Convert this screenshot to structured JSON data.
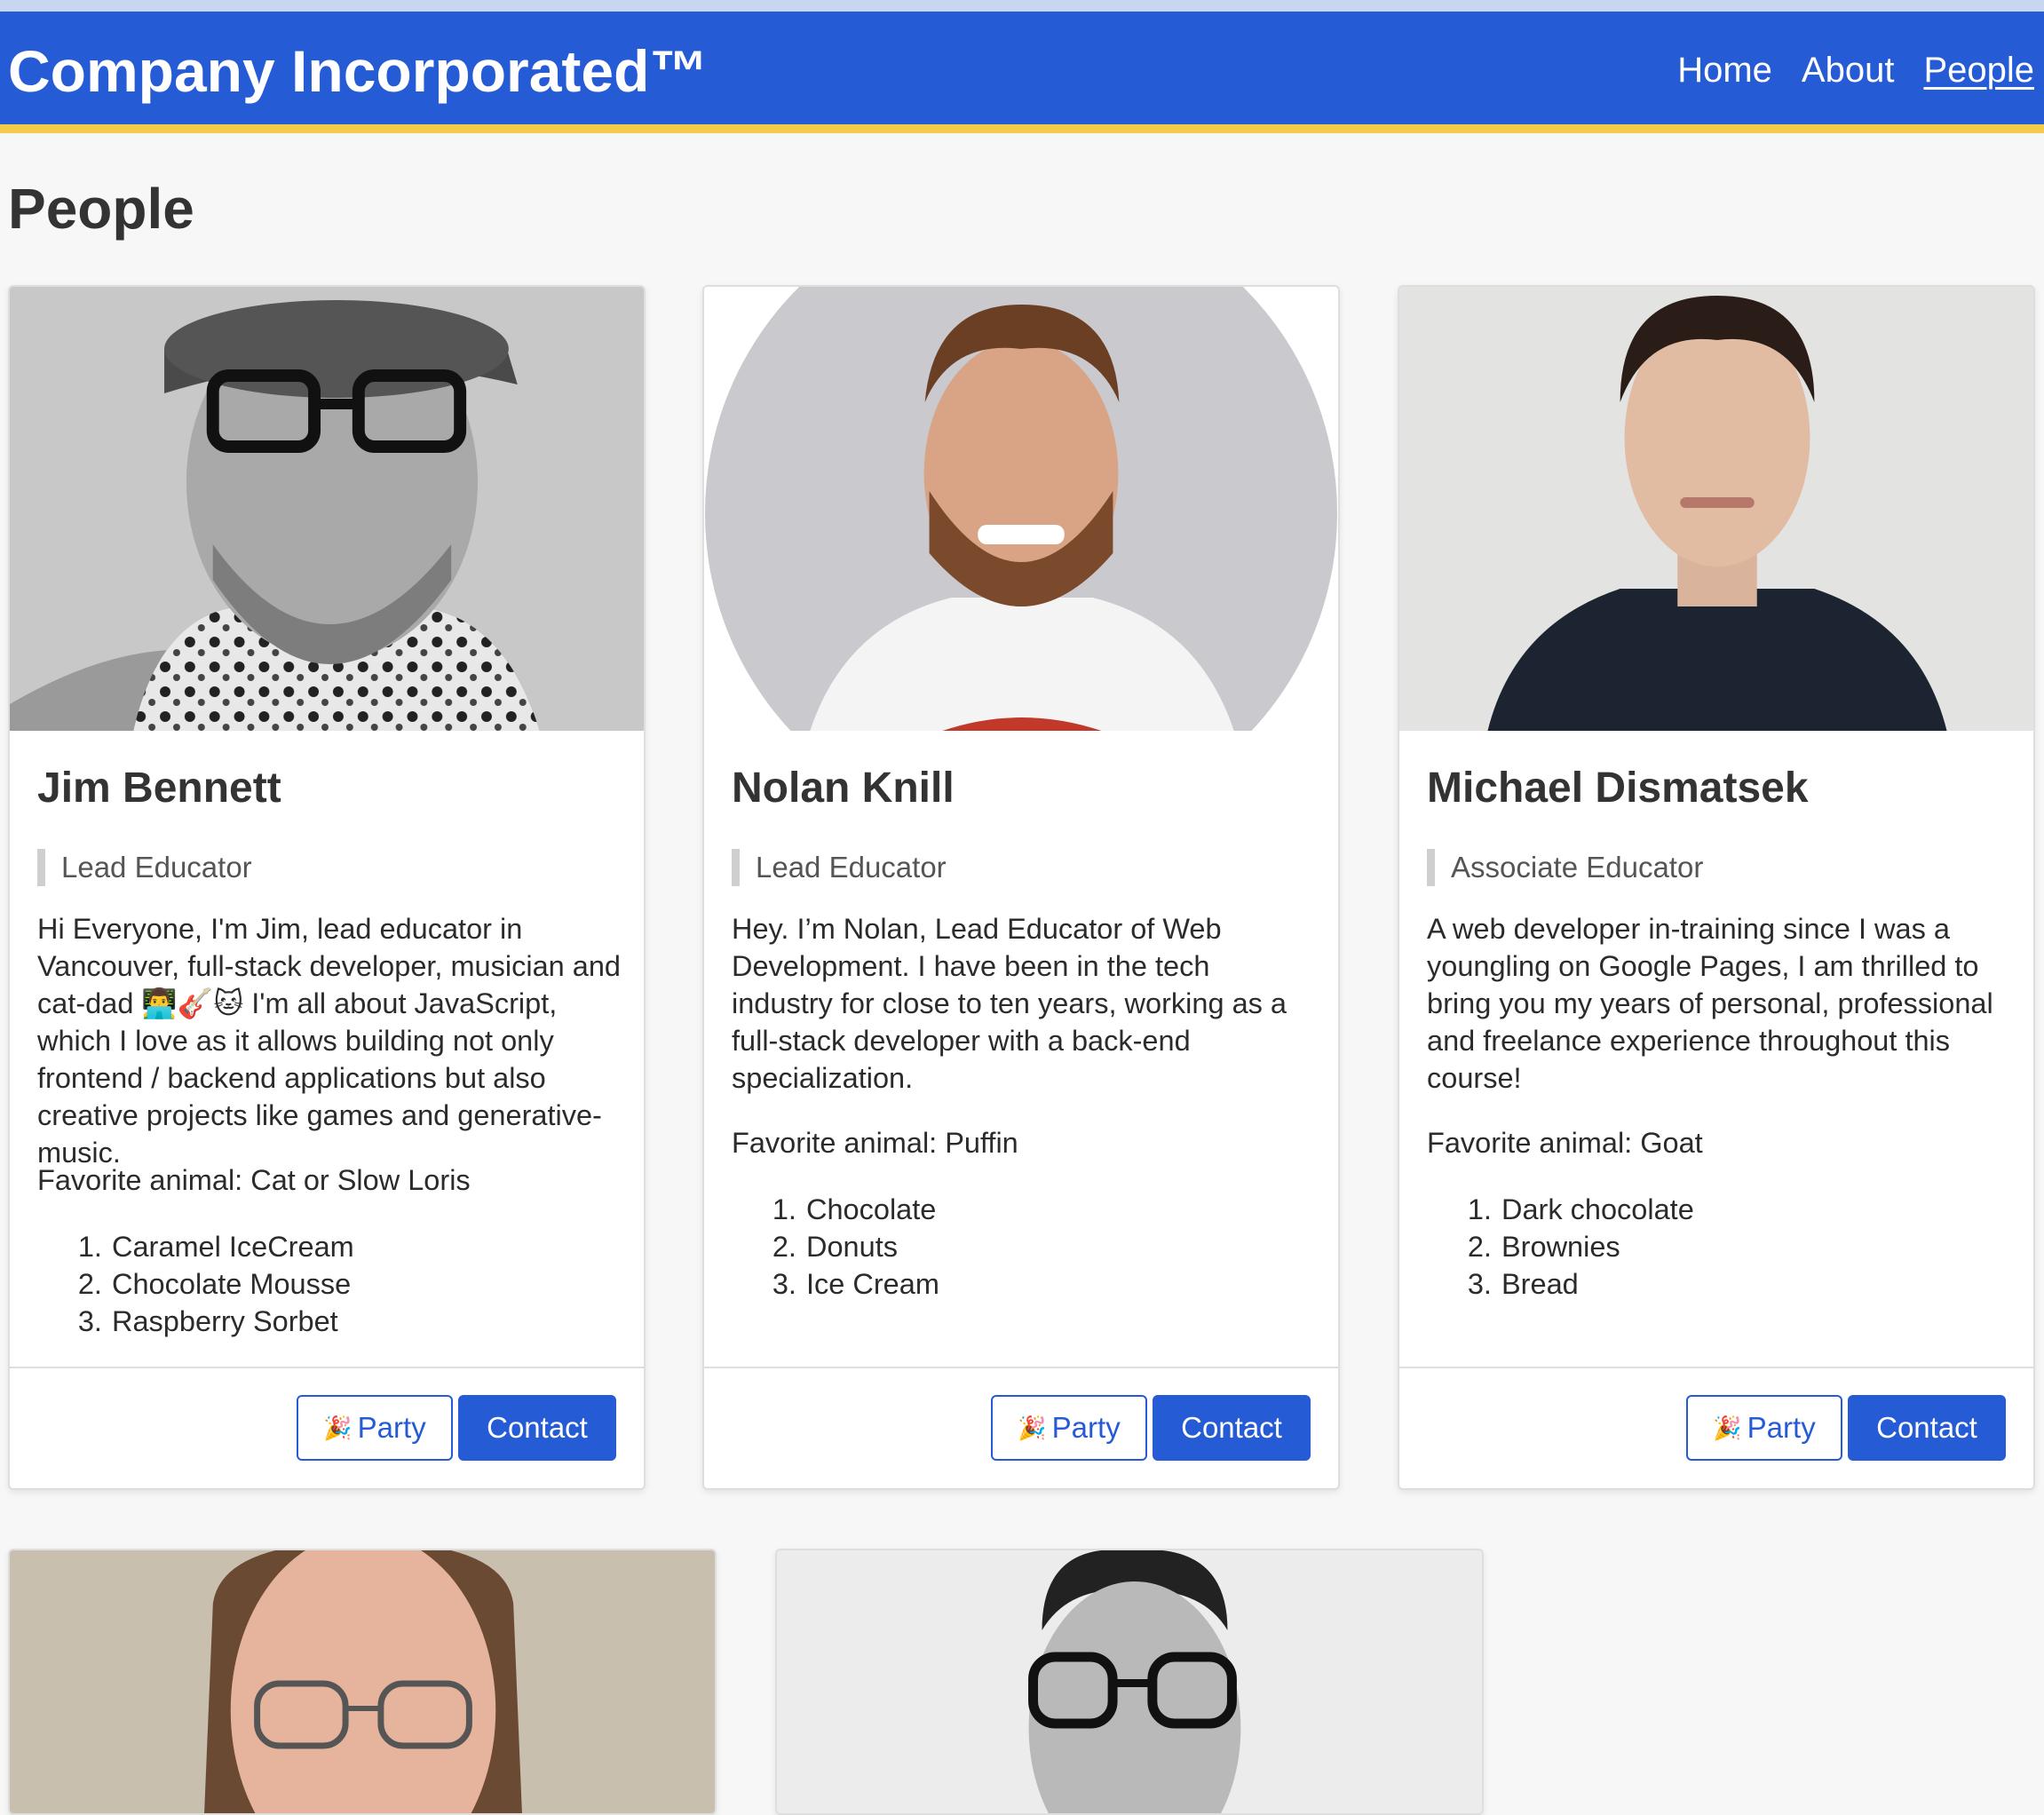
{
  "header": {
    "brand": "Company Incorporated™",
    "nav": [
      {
        "label": "Home",
        "active": false
      },
      {
        "label": "About",
        "active": false
      },
      {
        "label": "People",
        "active": true
      }
    ],
    "colors": {
      "primary": "#255bd4",
      "accent_border": "#f3cb49"
    }
  },
  "page": {
    "title": "People"
  },
  "people": [
    {
      "name": "Jim Bennett",
      "role": "Lead Educator",
      "bio": "Hi Everyone, I'm Jim, lead educator in Vancouver, full-stack developer, musician and cat-dad 👨‍💻🎸🐱 I'm all about JavaScript, which I love as it allows building not only frontend / backend applications but also creative projects like games and generative-music.",
      "favorite_animal": "Favorite animal: Cat or Slow Loris",
      "treats": [
        "Caramel IceCream",
        "Chocolate Mousse",
        "Raspberry Sorbet"
      ],
      "party_label": "Party",
      "party_icon": "party-popper-icon",
      "contact_label": "Contact"
    },
    {
      "name": "Nolan Knill",
      "role": "Lead Educator",
      "bio": "Hey. I’m Nolan, Lead Educator of Web Development. I have been in the tech industry for close to ten years, working as a full-stack developer with a back-end specialization.",
      "favorite_animal": "Favorite animal: Puffin",
      "treats": [
        "Chocolate",
        "Donuts",
        "Ice Cream"
      ],
      "party_label": "Party",
      "party_icon": "party-popper-icon",
      "contact_label": "Contact"
    },
    {
      "name": "Michael Dismatsek",
      "role": "Associate Educator",
      "bio": "A web developer in-training since I was a youngling on Google Pages, I am thrilled to bring you my years of personal, professional and freelance experience throughout this course!",
      "favorite_animal": "Favorite animal: Goat",
      "treats": [
        "Dark chocolate",
        "Brownies",
        "Bread"
      ],
      "party_label": "Party",
      "party_icon": "party-popper-icon",
      "contact_label": "Contact"
    }
  ],
  "party_emoji": "🎉"
}
